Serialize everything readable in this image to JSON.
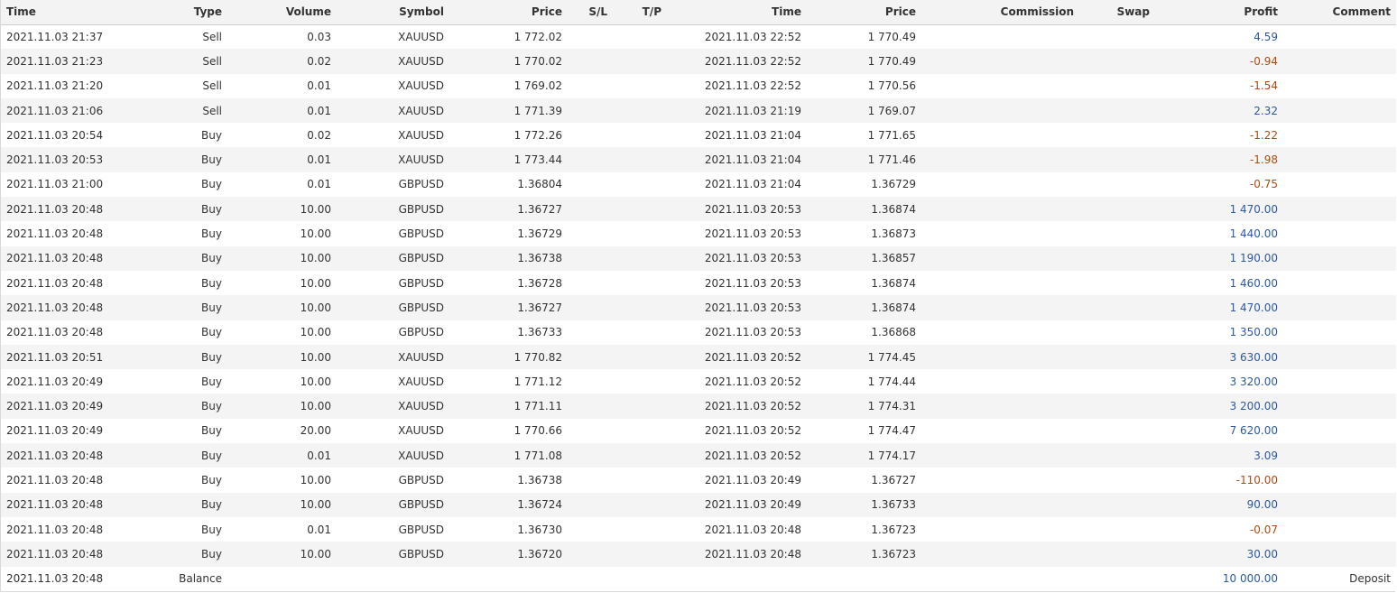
{
  "headers": [
    "Time",
    "Type",
    "Volume",
    "Symbol",
    "Price",
    "S/L",
    "T/P",
    "Time",
    "Price",
    "Commission",
    "Swap",
    "Profit",
    "Comment"
  ],
  "rows": [
    {
      "open_time": "2021.11.03 21:37",
      "type": "Sell",
      "volume": "0.03",
      "symbol": "XAUUSD",
      "open_price": "1 772.02",
      "sl": "",
      "tp": "",
      "close_time": "2021.11.03 22:52",
      "close_price": "1 770.49",
      "commission": "",
      "swap": "",
      "profit": "4.59",
      "comment": ""
    },
    {
      "open_time": "2021.11.03 21:23",
      "type": "Sell",
      "volume": "0.02",
      "symbol": "XAUUSD",
      "open_price": "1 770.02",
      "sl": "",
      "tp": "",
      "close_time": "2021.11.03 22:52",
      "close_price": "1 770.49",
      "commission": "",
      "swap": "",
      "profit": "-0.94",
      "comment": ""
    },
    {
      "open_time": "2021.11.03 21:20",
      "type": "Sell",
      "volume": "0.01",
      "symbol": "XAUUSD",
      "open_price": "1 769.02",
      "sl": "",
      "tp": "",
      "close_time": "2021.11.03 22:52",
      "close_price": "1 770.56",
      "commission": "",
      "swap": "",
      "profit": "-1.54",
      "comment": ""
    },
    {
      "open_time": "2021.11.03 21:06",
      "type": "Sell",
      "volume": "0.01",
      "symbol": "XAUUSD",
      "open_price": "1 771.39",
      "sl": "",
      "tp": "",
      "close_time": "2021.11.03 21:19",
      "close_price": "1 769.07",
      "commission": "",
      "swap": "",
      "profit": "2.32",
      "comment": ""
    },
    {
      "open_time": "2021.11.03 20:54",
      "type": "Buy",
      "volume": "0.02",
      "symbol": "XAUUSD",
      "open_price": "1 772.26",
      "sl": "",
      "tp": "",
      "close_time": "2021.11.03 21:04",
      "close_price": "1 771.65",
      "commission": "",
      "swap": "",
      "profit": "-1.22",
      "comment": ""
    },
    {
      "open_time": "2021.11.03 20:53",
      "type": "Buy",
      "volume": "0.01",
      "symbol": "XAUUSD",
      "open_price": "1 773.44",
      "sl": "",
      "tp": "",
      "close_time": "2021.11.03 21:04",
      "close_price": "1 771.46",
      "commission": "",
      "swap": "",
      "profit": "-1.98",
      "comment": ""
    },
    {
      "open_time": "2021.11.03 21:00",
      "type": "Buy",
      "volume": "0.01",
      "symbol": "GBPUSD",
      "open_price": "1.36804",
      "sl": "",
      "tp": "",
      "close_time": "2021.11.03 21:04",
      "close_price": "1.36729",
      "commission": "",
      "swap": "",
      "profit": "-0.75",
      "comment": ""
    },
    {
      "open_time": "2021.11.03 20:48",
      "type": "Buy",
      "volume": "10.00",
      "symbol": "GBPUSD",
      "open_price": "1.36727",
      "sl": "",
      "tp": "",
      "close_time": "2021.11.03 20:53",
      "close_price": "1.36874",
      "commission": "",
      "swap": "",
      "profit": "1 470.00",
      "comment": ""
    },
    {
      "open_time": "2021.11.03 20:48",
      "type": "Buy",
      "volume": "10.00",
      "symbol": "GBPUSD",
      "open_price": "1.36729",
      "sl": "",
      "tp": "",
      "close_time": "2021.11.03 20:53",
      "close_price": "1.36873",
      "commission": "",
      "swap": "",
      "profit": "1 440.00",
      "comment": ""
    },
    {
      "open_time": "2021.11.03 20:48",
      "type": "Buy",
      "volume": "10.00",
      "symbol": "GBPUSD",
      "open_price": "1.36738",
      "sl": "",
      "tp": "",
      "close_time": "2021.11.03 20:53",
      "close_price": "1.36857",
      "commission": "",
      "swap": "",
      "profit": "1 190.00",
      "comment": ""
    },
    {
      "open_time": "2021.11.03 20:48",
      "type": "Buy",
      "volume": "10.00",
      "symbol": "GBPUSD",
      "open_price": "1.36728",
      "sl": "",
      "tp": "",
      "close_time": "2021.11.03 20:53",
      "close_price": "1.36874",
      "commission": "",
      "swap": "",
      "profit": "1 460.00",
      "comment": ""
    },
    {
      "open_time": "2021.11.03 20:48",
      "type": "Buy",
      "volume": "10.00",
      "symbol": "GBPUSD",
      "open_price": "1.36727",
      "sl": "",
      "tp": "",
      "close_time": "2021.11.03 20:53",
      "close_price": "1.36874",
      "commission": "",
      "swap": "",
      "profit": "1 470.00",
      "comment": ""
    },
    {
      "open_time": "2021.11.03 20:48",
      "type": "Buy",
      "volume": "10.00",
      "symbol": "GBPUSD",
      "open_price": "1.36733",
      "sl": "",
      "tp": "",
      "close_time": "2021.11.03 20:53",
      "close_price": "1.36868",
      "commission": "",
      "swap": "",
      "profit": "1 350.00",
      "comment": ""
    },
    {
      "open_time": "2021.11.03 20:51",
      "type": "Buy",
      "volume": "10.00",
      "symbol": "XAUUSD",
      "open_price": "1 770.82",
      "sl": "",
      "tp": "",
      "close_time": "2021.11.03 20:52",
      "close_price": "1 774.45",
      "commission": "",
      "swap": "",
      "profit": "3 630.00",
      "comment": ""
    },
    {
      "open_time": "2021.11.03 20:49",
      "type": "Buy",
      "volume": "10.00",
      "symbol": "XAUUSD",
      "open_price": "1 771.12",
      "sl": "",
      "tp": "",
      "close_time": "2021.11.03 20:52",
      "close_price": "1 774.44",
      "commission": "",
      "swap": "",
      "profit": "3 320.00",
      "comment": ""
    },
    {
      "open_time": "2021.11.03 20:49",
      "type": "Buy",
      "volume": "10.00",
      "symbol": "XAUUSD",
      "open_price": "1 771.11",
      "sl": "",
      "tp": "",
      "close_time": "2021.11.03 20:52",
      "close_price": "1 774.31",
      "commission": "",
      "swap": "",
      "profit": "3 200.00",
      "comment": ""
    },
    {
      "open_time": "2021.11.03 20:49",
      "type": "Buy",
      "volume": "20.00",
      "symbol": "XAUUSD",
      "open_price": "1 770.66",
      "sl": "",
      "tp": "",
      "close_time": "2021.11.03 20:52",
      "close_price": "1 774.47",
      "commission": "",
      "swap": "",
      "profit": "7 620.00",
      "comment": ""
    },
    {
      "open_time": "2021.11.03 20:48",
      "type": "Buy",
      "volume": "0.01",
      "symbol": "XAUUSD",
      "open_price": "1 771.08",
      "sl": "",
      "tp": "",
      "close_time": "2021.11.03 20:52",
      "close_price": "1 774.17",
      "commission": "",
      "swap": "",
      "profit": "3.09",
      "comment": ""
    },
    {
      "open_time": "2021.11.03 20:48",
      "type": "Buy",
      "volume": "10.00",
      "symbol": "GBPUSD",
      "open_price": "1.36738",
      "sl": "",
      "tp": "",
      "close_time": "2021.11.03 20:49",
      "close_price": "1.36727",
      "commission": "",
      "swap": "",
      "profit": "-110.00",
      "comment": ""
    },
    {
      "open_time": "2021.11.03 20:48",
      "type": "Buy",
      "volume": "10.00",
      "symbol": "GBPUSD",
      "open_price": "1.36724",
      "sl": "",
      "tp": "",
      "close_time": "2021.11.03 20:49",
      "close_price": "1.36733",
      "commission": "",
      "swap": "",
      "profit": "90.00",
      "comment": ""
    },
    {
      "open_time": "2021.11.03 20:48",
      "type": "Buy",
      "volume": "0.01",
      "symbol": "GBPUSD",
      "open_price": "1.36730",
      "sl": "",
      "tp": "",
      "close_time": "2021.11.03 20:48",
      "close_price": "1.36723",
      "commission": "",
      "swap": "",
      "profit": "-0.07",
      "comment": ""
    },
    {
      "open_time": "2021.11.03 20:48",
      "type": "Buy",
      "volume": "10.00",
      "symbol": "GBPUSD",
      "open_price": "1.36720",
      "sl": "",
      "tp": "",
      "close_time": "2021.11.03 20:48",
      "close_price": "1.36723",
      "commission": "",
      "swap": "",
      "profit": "30.00",
      "comment": ""
    },
    {
      "open_time": "2021.11.03 20:48",
      "type": "Balance",
      "volume": "",
      "symbol": "",
      "open_price": "",
      "sl": "",
      "tp": "",
      "close_time": "",
      "close_price": "",
      "commission": "",
      "swap": "",
      "profit": "10 000.00",
      "comment": "Deposit"
    }
  ],
  "colors": {
    "profit_positive": "#2c5aa0",
    "profit_negative": "#b04a10",
    "header_bg": "#f3f3f3",
    "row_alt_bg": "#f4f4f4"
  }
}
